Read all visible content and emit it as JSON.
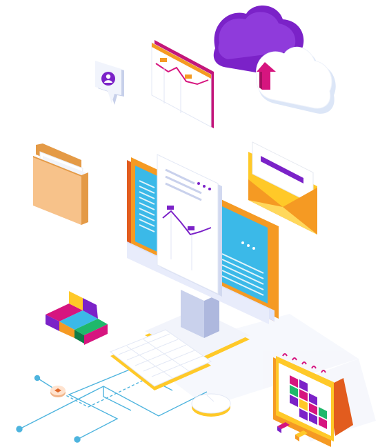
{
  "illustration": {
    "kind": "isometric cloud-computing illustration",
    "objects": [
      "cloud-purple-icon",
      "cloud-white-icon",
      "upload-arrow-icon",
      "profile-chat-bubble-icon",
      "chart-window-icon",
      "folder-icon",
      "mail-envelope-icon",
      "desktop-monitor-icon",
      "document-chart-icon",
      "color-blocks-icon",
      "keyboard-icon",
      "mouse-icon",
      "calendar-icon",
      "circuit-lines-icon"
    ]
  },
  "colors": {
    "purple": "#7B22C8",
    "magenta": "#D6157F",
    "orange": "#F59A23",
    "yellow": "#FFC928",
    "cyan": "#3BB9E8",
    "light_blue": "#DCE3FA",
    "teal_line": "#4EB4DE",
    "green": "#1FB86B",
    "white": "#FFFFFF"
  }
}
